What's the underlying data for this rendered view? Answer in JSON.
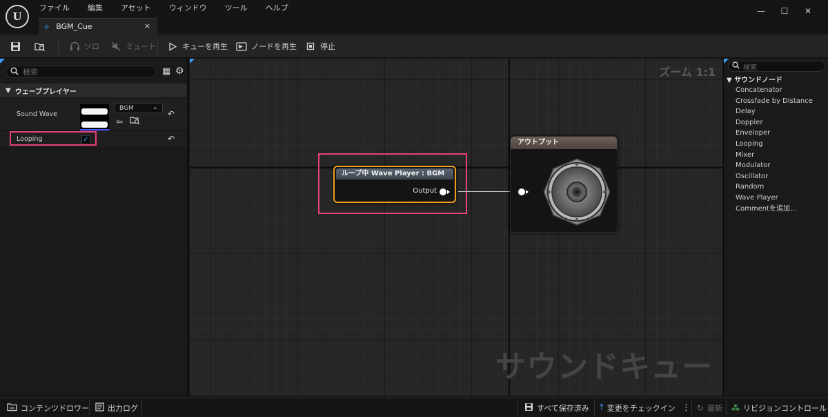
{
  "menu": [
    "ファイル",
    "編集",
    "アセット",
    "ウィンドウ",
    "ツール",
    "ヘルプ"
  ],
  "tab": {
    "label": "BGM_Cue",
    "close": "×"
  },
  "window_controls": {
    "minimize": "—",
    "maximize": "☐",
    "close": "✕"
  },
  "toolbar": {
    "solo": "ソロ",
    "mute": "ミュート",
    "play_cue": "キューを再生",
    "play_node": "ノードを再生",
    "stop": "停止"
  },
  "details": {
    "search_placeholder": "検索",
    "category": "ウェーブプレイヤー",
    "sound_wave_label": "Sound Wave",
    "sound_wave_value": "BGM",
    "looping_label": "Looping",
    "looping_checked": true
  },
  "graph": {
    "zoom": "ズーム 1:1",
    "watermark": "サウンドキュー",
    "wave_player_node": {
      "title": "ループ中 Wave Player : BGM",
      "output": "Output"
    },
    "output_node": {
      "title": "アウトプット"
    }
  },
  "palette": {
    "search_placeholder": "検索",
    "header": "サウンドノード",
    "items": [
      "Concatenator",
      "Crossfade by Distance",
      "Delay",
      "Doppler",
      "Enveloper",
      "Looping",
      "Mixer",
      "Modulator",
      "Oscillator",
      "Random",
      "Wave Player",
      "Commentを追加..."
    ]
  },
  "statusbar": {
    "content_drawer": "コンテンツドロワー",
    "output_log": "出力ログ",
    "save_all": "すべて保存済み",
    "check_in": "変更をチェックイン",
    "latest": "最新",
    "source_control": "リビジョンコントロール"
  },
  "colors": {
    "accent": "#3aa0ff",
    "highlight": "#e8417a",
    "selected_node": "#f0a020"
  }
}
